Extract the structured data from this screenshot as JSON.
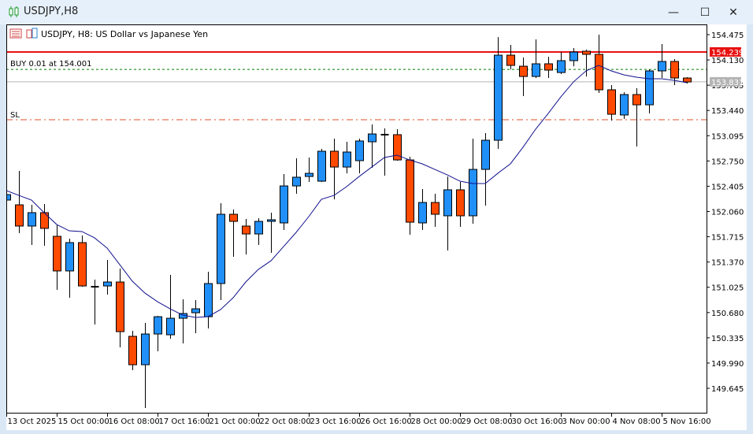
{
  "window": {
    "title": "USDJPY,H8",
    "icon": "candlestick-chart-icon",
    "buttons": [
      "minimize",
      "maximize",
      "close"
    ]
  },
  "chart_header": {
    "text": "USDJPY, H8:  US Dollar vs Japanese Yen",
    "icons": [
      "indicator-list-icon",
      "chart-template-icon"
    ]
  },
  "order": {
    "label": "BUY 0.01 at 154.001",
    "price": 154.001,
    "color": "#008000"
  },
  "stop_loss": {
    "label": "SL",
    "price": 153.313,
    "color": "#e0522a"
  },
  "ask_line": {
    "label": "154.239",
    "price": 154.239,
    "color": "#e81010"
  },
  "bid_line": {
    "label": "153.831",
    "price": 153.831,
    "color": "#b4b4b4"
  },
  "colors": {
    "bull": "#2090f8",
    "bear": "#ff4a00",
    "ma": "#10108c"
  },
  "chart_data": {
    "type": "candlestick",
    "symbol": "USDJPY",
    "timeframe": "H8",
    "ylim": [
      149.5,
      154.6
    ],
    "y_ticks": [
      "154.475",
      "154.130",
      "153.785",
      "153.440",
      "153.095",
      "152.750",
      "152.405",
      "152.060",
      "151.715",
      "151.370",
      "151.025",
      "150.680",
      "150.335",
      "149.990",
      "149.645"
    ],
    "x_labels": [
      {
        "index": 0,
        "label": "13 Oct 2025"
      },
      {
        "index": 4,
        "label": "15 Oct 00:00"
      },
      {
        "index": 8,
        "label": "16 Oct 08:00"
      },
      {
        "index": 12,
        "label": "17 Oct 16:00"
      },
      {
        "index": 16,
        "label": "21 Oct 00:00"
      },
      {
        "index": 20,
        "label": "22 Oct 08:00"
      },
      {
        "index": 24,
        "label": "23 Oct 16:00"
      },
      {
        "index": 28,
        "label": "26 Oct 16:00"
      },
      {
        "index": 32,
        "label": "28 Oct 00:00"
      },
      {
        "index": 36,
        "label": "29 Oct 08:00"
      },
      {
        "index": 40,
        "label": "30 Oct 16:00"
      },
      {
        "index": 44,
        "label": "3 Nov 00:00"
      },
      {
        "index": 48,
        "label": "4 Nov 08:00"
      },
      {
        "index": 52,
        "label": "5 Nov 16:00"
      }
    ],
    "ohlc": [
      [
        152.216,
        152.313,
        152.194,
        152.291
      ],
      [
        152.151,
        152.614,
        151.764,
        151.861
      ],
      [
        151.861,
        152.151,
        151.603,
        152.044
      ],
      [
        152.044,
        152.162,
        151.592,
        151.829
      ],
      [
        151.721,
        151.872,
        150.989,
        151.248
      ],
      [
        151.248,
        151.689,
        150.882,
        151.635
      ],
      [
        151.635,
        151.732,
        151.032,
        151.043
      ],
      [
        151.032,
        151.129,
        150.516,
        151.032
      ],
      [
        151.043,
        151.398,
        150.925,
        151.097
      ],
      [
        151.097,
        151.28,
        150.204,
        150.419
      ],
      [
        150.355,
        150.43,
        149.892,
        149.967
      ],
      [
        149.967,
        150.538,
        149.376,
        150.387
      ],
      [
        150.387,
        150.634,
        150.15,
        150.623
      ],
      [
        150.376,
        151.194,
        150.322,
        150.602
      ],
      [
        150.602,
        150.86,
        150.258,
        150.667
      ],
      [
        150.677,
        150.85,
        150.398,
        150.731
      ],
      [
        150.623,
        151.237,
        150.462,
        151.076
      ],
      [
        151.076,
        152.173,
        150.85,
        152.022
      ],
      [
        152.022,
        152.087,
        151.441,
        151.925
      ],
      [
        151.861,
        151.958,
        151.473,
        151.753
      ],
      [
        151.753,
        151.968,
        151.603,
        151.925
      ],
      [
        151.925,
        152.044,
        151.495,
        151.947
      ],
      [
        151.904,
        152.571,
        151.807,
        152.409
      ],
      [
        152.409,
        152.786,
        152.302,
        152.528
      ],
      [
        152.538,
        152.797,
        152.463,
        152.581
      ],
      [
        152.474,
        152.915,
        152.463,
        152.883
      ],
      [
        152.883,
        153.055,
        152.226,
        152.667
      ],
      [
        152.667,
        153.012,
        152.581,
        152.872
      ],
      [
        152.754,
        153.055,
        152.581,
        153.023
      ],
      [
        153.012,
        153.248,
        152.657,
        153.119
      ],
      [
        153.109,
        153.195,
        152.549,
        153.109
      ],
      [
        153.109,
        153.184,
        152.754,
        152.764
      ],
      [
        152.764,
        152.807,
        151.742,
        151.914
      ],
      [
        151.904,
        152.366,
        151.807,
        152.183
      ],
      [
        152.183,
        152.302,
        151.85,
        152.022
      ],
      [
        152.001,
        152.538,
        151.527,
        152.356
      ],
      [
        152.356,
        152.463,
        151.85,
        152.001
      ],
      [
        152.001,
        153.055,
        151.893,
        152.635
      ],
      [
        152.635,
        153.13,
        152.14,
        153.033
      ],
      [
        153.033,
        154.442,
        152.915,
        154.195
      ],
      [
        154.195,
        154.335,
        154.001,
        154.055
      ],
      [
        154.044,
        154.163,
        153.636,
        153.904
      ],
      [
        153.904,
        154.41,
        153.883,
        154.077
      ],
      [
        154.077,
        154.173,
        153.883,
        153.991
      ],
      [
        153.958,
        154.238,
        153.937,
        154.12
      ],
      [
        154.12,
        154.292,
        154.044,
        154.238
      ],
      [
        154.249,
        154.27,
        153.904,
        154.206
      ],
      [
        154.206,
        154.475,
        153.679,
        153.722
      ],
      [
        153.722,
        153.786,
        153.302,
        153.388
      ],
      [
        153.378,
        153.689,
        153.324,
        153.657
      ],
      [
        153.657,
        153.743,
        152.947,
        153.517
      ],
      [
        153.517,
        154.001,
        153.399,
        153.98
      ],
      [
        153.98,
        154.346,
        153.883,
        154.109
      ],
      [
        154.109,
        154.141,
        153.786,
        153.883
      ],
      [
        153.883,
        153.894,
        153.808,
        153.829
      ]
    ],
    "moving_average": [
      152.345,
      152.28,
      152.216,
      152.044,
      151.882,
      151.796,
      151.786,
      151.7,
      151.56,
      151.334,
      151.108,
      150.946,
      150.828,
      150.731,
      150.645,
      150.613,
      150.624,
      150.72,
      150.882,
      151.097,
      151.269,
      151.387,
      151.581,
      151.775,
      151.99,
      152.226,
      152.28,
      152.399,
      152.538,
      152.667,
      152.797,
      152.829,
      152.764,
      152.711,
      152.635,
      152.56,
      152.474,
      152.442,
      152.442,
      152.581,
      152.711,
      152.937,
      153.184,
      153.399,
      153.625,
      153.829,
      153.98,
      154.055,
      153.98,
      153.926,
      153.894,
      153.872,
      153.872,
      153.851,
      153.819
    ],
    "grid": false
  }
}
